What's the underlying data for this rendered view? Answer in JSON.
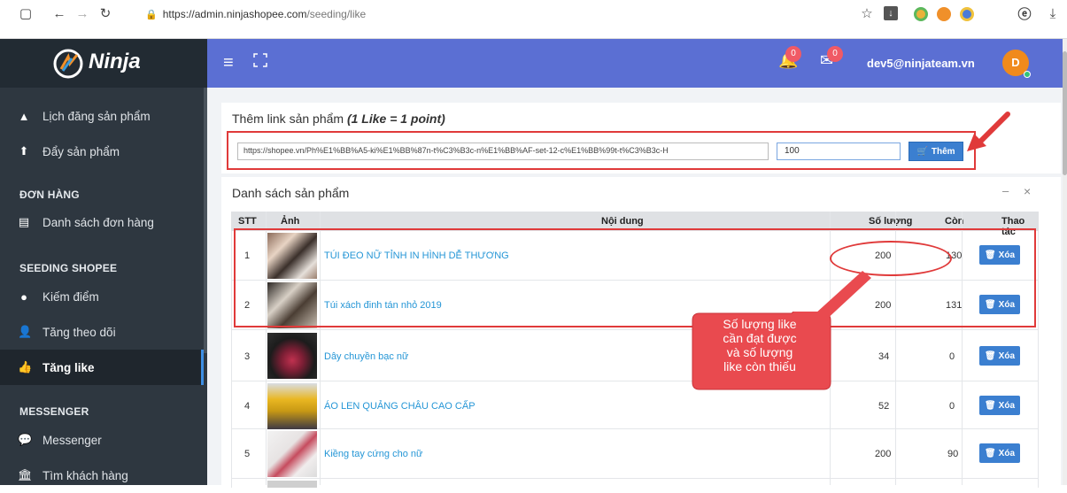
{
  "browser": {
    "url_host": "https://admin.ninjashopee.com",
    "url_path": "/seeding/like"
  },
  "header": {
    "logo_text": "Ninja",
    "notif_count": "0",
    "mail_count": "0",
    "user_email": "dev5@ninjateam.vn",
    "avatar_letter": "D"
  },
  "sidebar": {
    "items_top": [
      {
        "label": "Lịch đăng sản phẩm",
        "icon": "bell-icon"
      },
      {
        "label": "Đẩy sản phẩm",
        "icon": "upload-icon"
      }
    ],
    "section_orders": "ĐƠN HÀNG",
    "orders_item": "Danh sách đơn hàng",
    "section_seeding": "SEEDING SHOPEE",
    "seeding_items": [
      {
        "label": "Kiếm điểm",
        "icon": "coin-icon"
      },
      {
        "label": "Tăng theo dõi",
        "icon": "user-plus-icon"
      },
      {
        "label": "Tăng like",
        "icon": "thumbs-up-icon"
      }
    ],
    "section_messenger": "MESSENGER",
    "messenger_items": [
      {
        "label": "Messenger",
        "icon": "chat-icon"
      },
      {
        "label": "Tìm khách hàng",
        "icon": "bank-icon"
      }
    ]
  },
  "add_panel": {
    "title": "Thêm link sản phẩm",
    "title_note": "(1 Like = 1 point)",
    "link_value": "https://shopee.vn/Ph%E1%BB%A5-ki%E1%BB%87n-t%C3%B3c-n%E1%BB%AF-set-12-c%E1%BB%99t-t%C3%B3c-H",
    "qty_value": "100",
    "add_button": "Thêm"
  },
  "list_panel": {
    "title": "Danh sách sản phẩm",
    "minimize": "–",
    "close": "×",
    "columns": [
      "STT",
      "Ảnh",
      "Nội dung",
      "Số lượng",
      "Còn",
      "Thao tác"
    ],
    "delete_label": "Xóa",
    "rows": [
      {
        "stt": "1",
        "name": "TÚI ĐEO NỮ TỈNH IN HÌNH DỄ THƯƠNG",
        "qty": "200",
        "remain": "130"
      },
      {
        "stt": "2",
        "name": "Túi xách đinh tán nhỏ 2019",
        "qty": "200",
        "remain": "131"
      },
      {
        "stt": "3",
        "name": "Dây chuyền bạc nữ",
        "qty": "34",
        "remain": "0"
      },
      {
        "stt": "4",
        "name": "ÁO LEN QUẢNG CHÂU CAO CẤP",
        "qty": "52",
        "remain": "0"
      },
      {
        "stt": "5",
        "name": "Kiềng tay cứng cho nữ",
        "qty": "200",
        "remain": "90"
      }
    ]
  },
  "callout": {
    "lines": [
      "Số lượng like",
      "cần đạt được",
      "và số lượng",
      "like còn thiếu"
    ]
  },
  "colors": {
    "topbar": "#5b6fd3",
    "sidebar": "#2e3740",
    "accent": "#3b7fd0",
    "annotation": "#e03a3a"
  }
}
